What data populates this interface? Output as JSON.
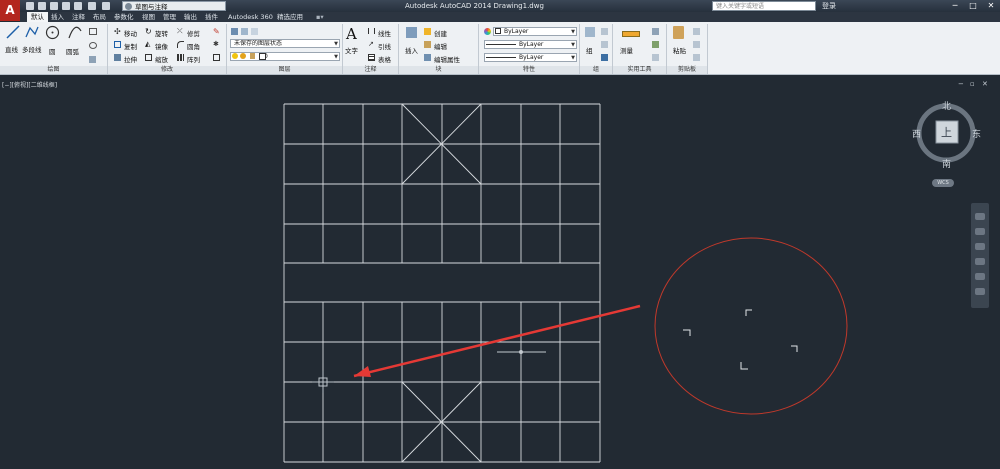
{
  "app": {
    "logo_letter": "A",
    "window_title": "Autodesk AutoCAD 2014    Drawing1.dwg",
    "workspace": "草图与注释",
    "search_placeholder": "键入关键字或短语",
    "login": "登录",
    "window_buttons": [
      "─",
      "□",
      "✕"
    ]
  },
  "tabs": [
    "默认",
    "插入",
    "注释",
    "布局",
    "参数化",
    "视图",
    "管理",
    "输出",
    "插件",
    "Autodesk 360",
    "精选应用"
  ],
  "active_tab": "默认",
  "ribbon": {
    "draw": {
      "line": "直线",
      "polyline": "多段线",
      "circle": "圆",
      "arc": "圆弧",
      "group": "绘图"
    },
    "modify": {
      "move": "移动",
      "rotate": "旋转",
      "trim": "修剪",
      "copy": "复制",
      "mirror": "镜像",
      "fillet": "圆角",
      "stretch": "拉伸",
      "scale": "缩放",
      "array": "阵列",
      "group": "修改"
    },
    "layers": {
      "layer_state": "未保存的图层状态",
      "current_layer": "0",
      "group": "图层"
    },
    "annotation": {
      "text": "文字",
      "linear": "线性",
      "leader": "引线",
      "table": "表格",
      "group": "注释"
    },
    "block": {
      "insert": "插入",
      "create": "创建",
      "edit": "编辑",
      "edit_attributes": "编辑属性",
      "group": "块"
    },
    "properties": {
      "color": "ByLayer",
      "linetype": "ByLayer",
      "lineweight": "ByLayer",
      "group": "特性"
    },
    "groups": {
      "group_btn": "组",
      "group": "组"
    },
    "utilities": {
      "measure": "测量",
      "group": "实用工具"
    },
    "clipboard": {
      "paste": "粘贴",
      "group": "剪贴板"
    }
  },
  "viewport": {
    "label": "[−][俯视][二维线框]",
    "controls": [
      "−",
      "▫",
      "✕"
    ]
  },
  "viewcube": {
    "north": "北",
    "south": "南",
    "east": "东",
    "west": "西",
    "top": "上",
    "wcs": "WCS"
  },
  "colors": {
    "canvas": "#222a33",
    "grid_lines": "#d7dbdf",
    "annotation_circle": "#c0392b",
    "arrow": "#e53935"
  }
}
